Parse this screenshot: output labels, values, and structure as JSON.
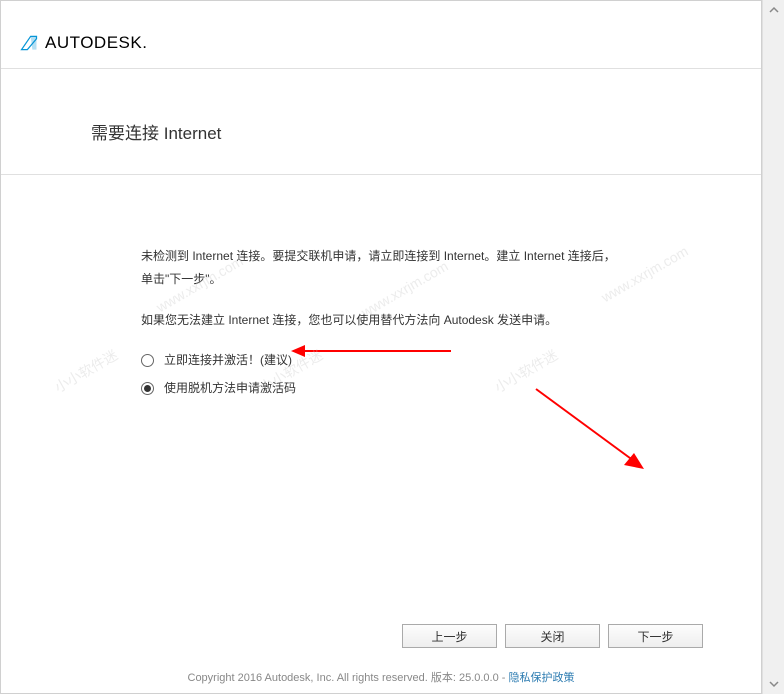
{
  "header": {
    "brand": "AUTODESK."
  },
  "title": "需要连接 Internet",
  "content": {
    "p1": "未检测到 Internet 连接。要提交联机申请，请立即连接到 Internet。建立 Internet 连接后，单击\"下一步\"。",
    "p2": "如果您无法建立 Internet 连接，您也可以使用替代方法向 Autodesk 发送申请。"
  },
  "radios": [
    {
      "label": "立即连接并激活！(建议)",
      "selected": false
    },
    {
      "label": "使用脱机方法申请激活码",
      "selected": true
    }
  ],
  "buttons": {
    "back": "上一步",
    "close": "关闭",
    "next": "下一步"
  },
  "footer": {
    "copyright": "Copyright 2016 Autodesk, Inc. All rights reserved. 版本: 25.0.0.0 - ",
    "privacy": "隐私保护政策"
  },
  "watermark": "小小软件迷  www.xxrjm.com"
}
